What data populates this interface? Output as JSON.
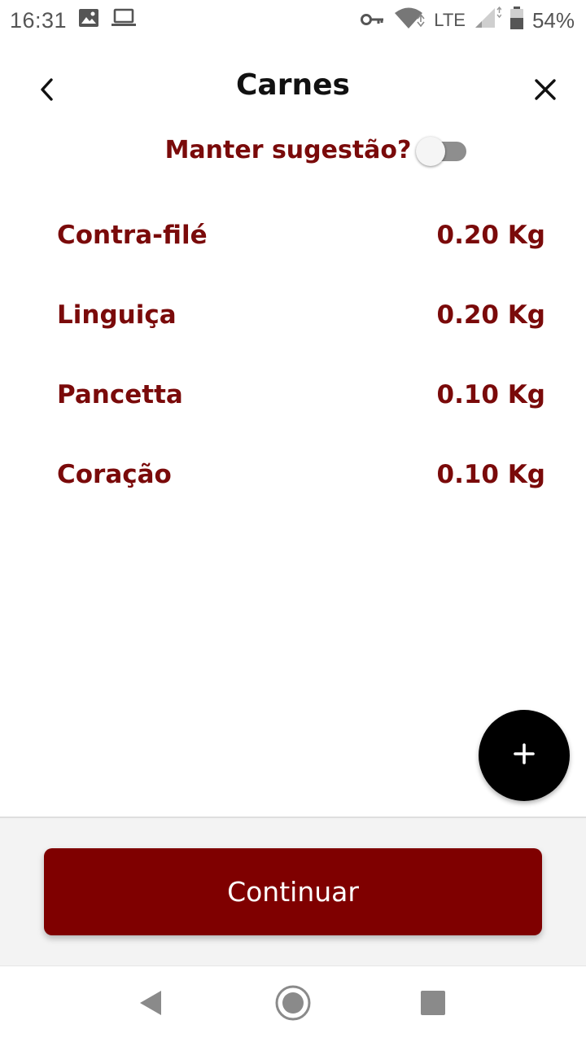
{
  "status_bar": {
    "time": "16:31",
    "network": "LTE",
    "battery": "54%",
    "icons": [
      "image-icon",
      "laptop-icon",
      "key-icon",
      "wifi-icon",
      "signal-icon",
      "battery-icon"
    ]
  },
  "header": {
    "title": "Carnes",
    "back_icon": "chevron-left-icon",
    "close_icon": "close-icon"
  },
  "keep_suggestion": {
    "label": "Manter sugestão?",
    "enabled": false
  },
  "items": [
    {
      "name": "Contra-filé",
      "quantity": "0.20 Kg"
    },
    {
      "name": "Linguiça",
      "quantity": "0.20 Kg"
    },
    {
      "name": "Pancetta",
      "quantity": "0.10 Kg"
    },
    {
      "name": "Coração",
      "quantity": "0.10 Kg"
    }
  ],
  "fab": {
    "icon": "plus-icon"
  },
  "footer": {
    "continue_label": "Continuar"
  },
  "colors": {
    "accent": "#7f0000",
    "text_accent": "#7a0a0a",
    "fab": "#000000"
  }
}
